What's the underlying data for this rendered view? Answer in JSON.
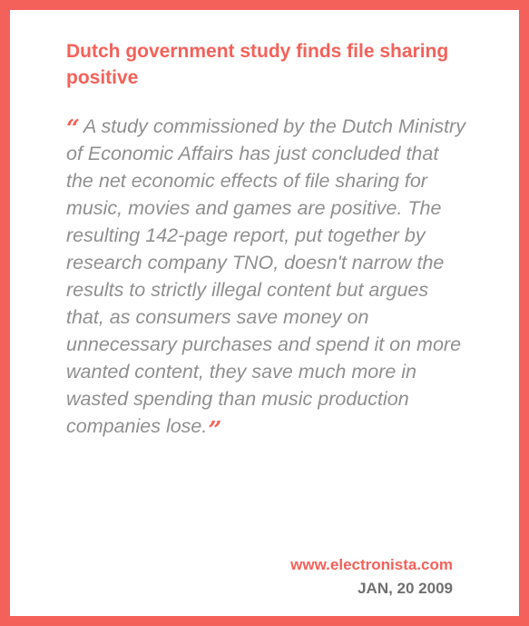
{
  "article": {
    "title": "Dutch government study finds file sharing positive",
    "open_quote": "“",
    "quote": "A study commissioned by the Dutch Ministry of Economic Affairs has just concluded that the net economic effects of file sharing for music, movies and games are positive. The resulting 142-page report, put together by research company TNO, doesn't narrow the results to strictly illegal content but argues that, as consumers save money on unnecessary purchases and spend it on more wanted content, they save much more in wasted spending than music production companies lose.",
    "close_quote": "”",
    "source": "www.electronista.com",
    "date": "JAN, 20 2009"
  },
  "colors": {
    "accent": "#f4615a",
    "quote_text": "#8f8f8f",
    "date_text": "#707070",
    "background": "#ffffff"
  }
}
